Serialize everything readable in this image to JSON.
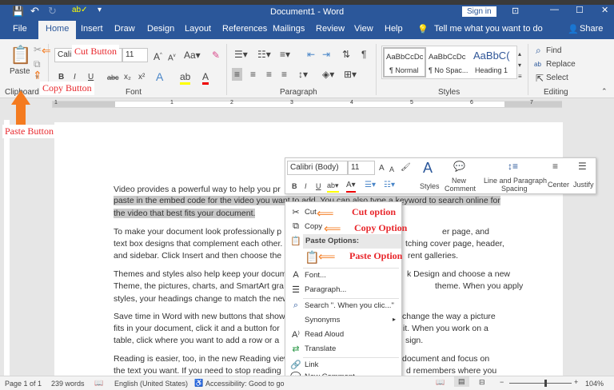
{
  "window": {
    "title": "Document1  -  Word",
    "sign_in": "Sign in"
  },
  "tabs": [
    "File",
    "Home",
    "Insert",
    "Draw",
    "Design",
    "Layout",
    "References",
    "Mailings",
    "Review",
    "View",
    "Help"
  ],
  "tell_me": "Tell me what you want to do",
  "share": "Share",
  "ribbon": {
    "clipboard": {
      "paste": "Paste",
      "label": "Clipboard"
    },
    "font": {
      "name": "Calibri",
      "size": "11",
      "label": "Font",
      "bold": "B",
      "italic": "I",
      "underline": "U",
      "strike": "abc",
      "sub": "x₂",
      "sup": "x²"
    },
    "paragraph": {
      "label": "Paragraph"
    },
    "styles": {
      "label": "Styles",
      "items": [
        {
          "preview": "AaBbCcDc",
          "name": "¶ Normal"
        },
        {
          "preview": "AaBbCcDc",
          "name": "¶ No Spac..."
        },
        {
          "preview": "AaBbC(",
          "name": "Heading 1"
        }
      ]
    },
    "editing": {
      "label": "Editing",
      "find": "Find",
      "replace": "Replace",
      "select": "Select"
    }
  },
  "ruler_numbers": [
    "1",
    "1",
    "2",
    "3",
    "4",
    "5",
    "6",
    "7"
  ],
  "document": {
    "lines": [
      {
        "left": "Video provides a powerful way to help you pr",
        "right": ""
      },
      {
        "left": "paste in the embed code for the video you want to add. You can also type a keyword to search online for",
        "right": "",
        "selected": true
      },
      {
        "left": "the video that best fits your document.",
        "right": "",
        "selected": true
      },
      {
        "left": "To make your document look professionally p",
        "right": "er page, and"
      },
      {
        "left": "text box designs that complement each other.",
        "right": "tching cover page, header,"
      },
      {
        "left": "and sidebar. Click Insert and then choose the",
        "right": "rent galleries."
      },
      {
        "left": "Themes and styles also help keep your docum",
        "right": "k Design and choose a new"
      },
      {
        "left": "Theme, the pictures, charts, and SmartArt gra",
        "right": "theme. When you apply"
      },
      {
        "left": "styles, your headings change to match the new",
        "right": ""
      },
      {
        "left": "Save time in Word with new buttons that show",
        "right": "change the way a picture"
      },
      {
        "left": "fits in your document, click it and a button for",
        "right": "it. When you work on a"
      },
      {
        "left": "table, click where you want to add a row or a",
        "right": "sign."
      },
      {
        "left": "Reading is easier, too, in the new Reading view",
        "right": "document and focus on"
      },
      {
        "left": "the text you want. If you need to stop reading",
        "right": "d remembers where you"
      }
    ]
  },
  "minibar": {
    "font": "Calibri (Body)",
    "size": "11",
    "styles": "Styles",
    "new_comment_1": "New",
    "new_comment_2": "Comment",
    "spacing_1": "Line and Paragraph",
    "spacing_2": "Spacing",
    "center": "Center",
    "justify": "Justify",
    "bold": "B",
    "italic": "I",
    "underline": "U"
  },
  "context_menu": {
    "cut": "Cut",
    "copy": "Copy",
    "paste_options": "Paste Options:",
    "font": "Font...",
    "paragraph": "Paragraph...",
    "search": "Search \". When you clic...\"",
    "synonyms": "Synonyms",
    "read_aloud": "Read Aloud",
    "translate": "Translate",
    "link": "Link",
    "new_comment": "New Comment"
  },
  "annotations": {
    "cut_button": "Cut Button",
    "copy_button": "Copy Button",
    "paste_button": "Paste Button",
    "cut_option": "Cut option",
    "copy_option": "Copy Option",
    "paste_option": "Paste Option"
  },
  "status": {
    "page": "Page 1 of 1",
    "words": "239 words",
    "language": "English (United States)",
    "accessibility": "Accessibility: Good to go",
    "zoom": "104%"
  },
  "colors": {
    "brand": "#2b579a",
    "annotation": "#e8262b",
    "arrow": "#f47b20"
  }
}
